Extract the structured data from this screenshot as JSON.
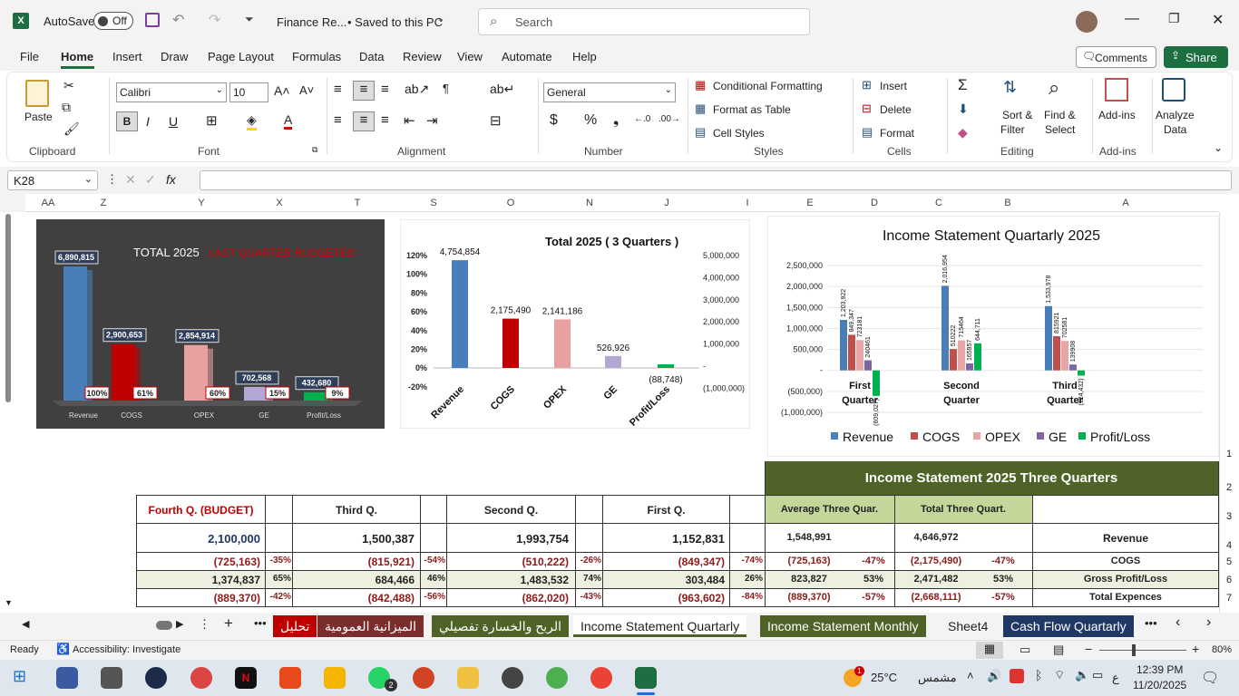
{
  "titlebar": {
    "autosave": "AutoSave",
    "autosave_state": "Off",
    "filename": "Finance Re...",
    "saved": "• Saved to this PC",
    "search_placeholder": "Search"
  },
  "menu": [
    "File",
    "Home",
    "Insert",
    "Draw",
    "Page Layout",
    "Formulas",
    "Data",
    "Review",
    "View",
    "Automate",
    "Help"
  ],
  "menu_right": {
    "comments": "Comments",
    "share": "Share"
  },
  "ribbon": {
    "clipboard": {
      "paste": "Paste",
      "label": "Clipboard"
    },
    "font": {
      "name": "Calibri",
      "size": "10",
      "label": "Font"
    },
    "alignment": {
      "label": "Alignment"
    },
    "number": {
      "format": "General",
      "label": "Number"
    },
    "styles": {
      "cond": "Conditional Formatting",
      "table": "Format as Table",
      "cell": "Cell Styles",
      "label": "Styles"
    },
    "cells": {
      "insert": "Insert",
      "delete": "Delete",
      "format": "Format",
      "label": "Cells"
    },
    "editing": {
      "sort": "Sort &",
      "sort2": "Filter",
      "find": "Find &",
      "find2": "Select",
      "label": "Editing"
    },
    "addins": {
      "addins": "Add-ins",
      "label": "Add-ins",
      "analyze": "Analyze",
      "analyze2": "Data"
    }
  },
  "formula_bar": {
    "namebox": "K28",
    "fx": "fx"
  },
  "columns": [
    "AA",
    "Z",
    "Y",
    "X",
    "T",
    "S",
    "O",
    "N",
    "J",
    "I",
    "E",
    "D",
    "C",
    "B",
    "A"
  ],
  "rows": [
    "1",
    "2",
    "3",
    "4",
    "5",
    "6",
    "7"
  ],
  "chart_data": [
    {
      "type": "bar",
      "title": "TOTAL 2025",
      "subtitle": "LAST QUARTER BUDGETED",
      "categories": [
        "Revenue",
        "COGS",
        "OPEX",
        "GE",
        "Profit/Loss"
      ],
      "values": [
        6890815,
        2900653,
        2854914,
        702568,
        432680
      ],
      "value_labels": [
        "6,890,815",
        "2,900,653",
        "2,854,914",
        "702,568",
        "432,680"
      ],
      "percent_labels": [
        "100%",
        "61%",
        "60%",
        "15%",
        "9%"
      ],
      "colors": [
        "#4a7ebb",
        "#c00000",
        "#e8a0a0",
        "#b4a7d6",
        "#00b050"
      ]
    },
    {
      "type": "bar",
      "title": "Total 2025 ( 3 Quarters )",
      "categories": [
        "Revenue",
        "COGS",
        "OPEX",
        "GE",
        "Profit/Loss"
      ],
      "values": [
        4754854,
        2175490,
        2141186,
        526926,
        -88748
      ],
      "value_labels": [
        "4,754,854",
        "2,175,490",
        "2,141,186",
        "526,926",
        "(88,748)"
      ],
      "left_ticks": [
        "120%",
        "100%",
        "80%",
        "60%",
        "40%",
        "20%",
        "0%",
        "-20%"
      ],
      "right_ticks": [
        "5,000,000",
        "4,000,000",
        "3,000,000",
        "2,000,000",
        "1,000,000",
        "-",
        "(1,000,000)"
      ],
      "ylim": [
        -1000000,
        5000000
      ],
      "colors": [
        "#4a7ebb",
        "#c00000",
        "#e8a0a0",
        "#b4a7d6",
        "#00b050"
      ]
    },
    {
      "type": "bar",
      "title": "Income Statement Quartarly 2025",
      "categories": [
        "First Quarter",
        "Second Quarter",
        "Third Quarter"
      ],
      "y_ticks": [
        "2,500,000",
        "2,000,000",
        "1,500,000",
        "1,000,000",
        "500,000",
        "-",
        "(500,000)",
        "(1,000,000)"
      ],
      "ylim": [
        -1000000,
        2500000
      ],
      "series": [
        {
          "name": "Revenue",
          "values": [
            1203922,
            2016954,
            1533978
          ],
          "labels": [
            "1,203,922",
            "2,016,954",
            "1,533,978"
          ],
          "color": "#4a7ebb"
        },
        {
          "name": "COGS",
          "values": [
            849347,
            510222,
            815921
          ],
          "labels": [
            "849,347",
            "510222",
            "815921"
          ],
          "color": "#c0504d"
        },
        {
          "name": "OPEX",
          "values": [
            723181,
            715464,
            702581
          ],
          "labels": [
            "723181",
            "715464",
            "702581"
          ],
          "color": "#e6a6a6"
        },
        {
          "name": "GE",
          "values": [
            240461,
            165957,
            139908
          ],
          "labels": [
            "240461",
            "165957",
            "139908"
          ],
          "color": "#8064a2"
        },
        {
          "name": "Profit/Loss",
          "values": [
            -609027,
            644711,
            -124432
          ],
          "labels": [
            "(609,027)",
            "644,711",
            "(124,432)"
          ],
          "color": "#00b050"
        }
      ]
    }
  ],
  "table": {
    "title": "Income Statement 2025 Three Quarters",
    "headers": [
      "Fourth Q. (BUDGET)",
      "Third Q.",
      "Second Q.",
      "First Q.",
      "Average Three Quar.",
      "Total Three Quart."
    ],
    "rows": [
      {
        "label": "Revenue",
        "q4": "2,100,000",
        "q4p": "",
        "q3": "1,500,387",
        "q3p": "",
        "q2": "1,993,754",
        "q2p": "",
        "q1": "1,152,831",
        "q1p": "",
        "avg": "1,548,991",
        "avgp": "",
        "tot": "4,646,972",
        "totp": ""
      },
      {
        "label": "COGS",
        "q4": "(725,163)",
        "q4p": "-35%",
        "q3": "(815,921)",
        "q3p": "-54%",
        "q2": "(510,222)",
        "q2p": "-26%",
        "q1": "(849,347)",
        "q1p": "-74%",
        "avg": "(725,163)",
        "avgp": "-47%",
        "tot": "(2,175,490)",
        "totp": "-47%"
      },
      {
        "label": "Gross Profit/Loss",
        "q4": "1,374,837",
        "q4p": "65%",
        "q3": "684,466",
        "q3p": "46%",
        "q2": "1,483,532",
        "q2p": "74%",
        "q1": "303,484",
        "q1p": "26%",
        "avg": "823,827",
        "avgp": "53%",
        "tot": "2,471,482",
        "totp": "53%"
      },
      {
        "label": "Total Expences",
        "q4": "(889,370)",
        "q4p": "-42%",
        "q3": "(842,488)",
        "q3p": "-56%",
        "q2": "(862,020)",
        "q2p": "-43%",
        "q1": "(963,602)",
        "q1p": "-84%",
        "avg": "(889,370)",
        "avgp": "-57%",
        "tot": "(2,668,111)",
        "totp": "-57%"
      }
    ]
  },
  "sheet_tabs": [
    {
      "label": "تحليل",
      "color": "#c00000"
    },
    {
      "label": "الميزانية العمومية",
      "color": "#7b2c2c"
    },
    {
      "label": "الربح والخسارة تفصيلي",
      "color": "#4f6228"
    },
    {
      "label": "Income Statement Quartarly",
      "color": "active"
    },
    {
      "label": "Income Statement Monthly",
      "color": "#4f6228"
    },
    {
      "label": "Sheet4",
      "color": "none"
    },
    {
      "label": "Cash Flow Quartarly",
      "color": "#1f3864"
    }
  ],
  "status": {
    "ready": "Ready",
    "accessibility": "Accessibility: Investigate",
    "zoom": "80%"
  },
  "taskbar": {
    "weather": "25°C",
    "weather_label": "مشمس",
    "time": "12:39 PM",
    "date": "11/20/2025",
    "lang": "ع",
    "badge": "1",
    "whatsapp_badge": "2"
  }
}
